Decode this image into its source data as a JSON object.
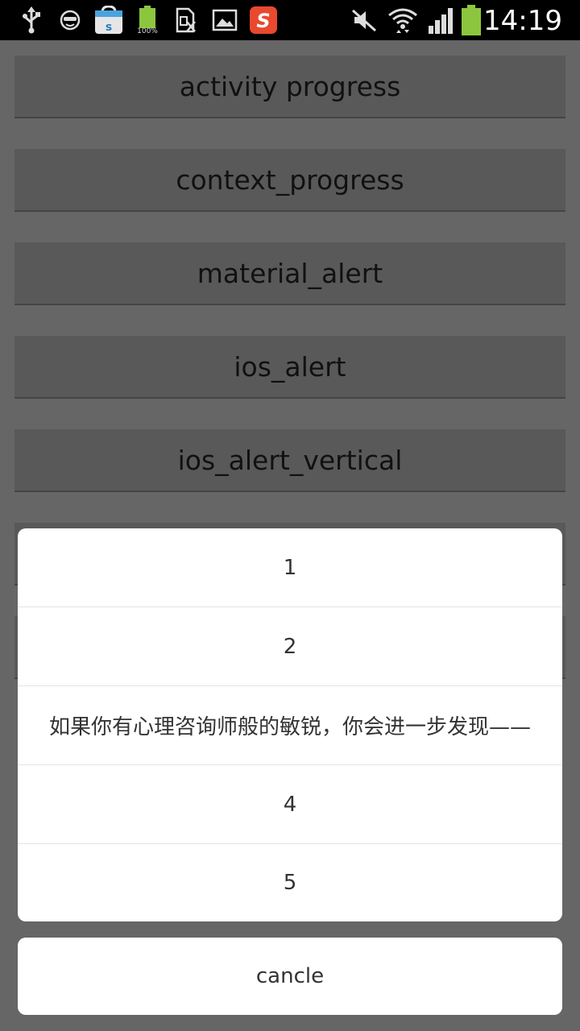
{
  "status_bar": {
    "time": "14:19",
    "battery_small_label": "100%",
    "icons": [
      "usb-icon",
      "face-icon",
      "store-icon",
      "battery-full-icon",
      "sim-icon",
      "image-icon",
      "sogou-icon",
      "mute-icon",
      "wifi-icon",
      "signal-icon",
      "battery-icon"
    ],
    "accent_green": "#8cc63f",
    "sogou_red": "#e8492f"
  },
  "buttons": [
    {
      "label": "activity progress"
    },
    {
      "label": "context_progress"
    },
    {
      "label": "material_alert"
    },
    {
      "label": "ios_alert"
    },
    {
      "label": "ios_alert_vertical"
    }
  ],
  "action_sheet": {
    "items": [
      {
        "label": "1"
      },
      {
        "label": "2"
      },
      {
        "label": "如果你有心理咨询师般的敏锐，你会进一步发现——"
      },
      {
        "label": "4"
      },
      {
        "label": "5"
      }
    ],
    "cancel_label": "cancle"
  }
}
